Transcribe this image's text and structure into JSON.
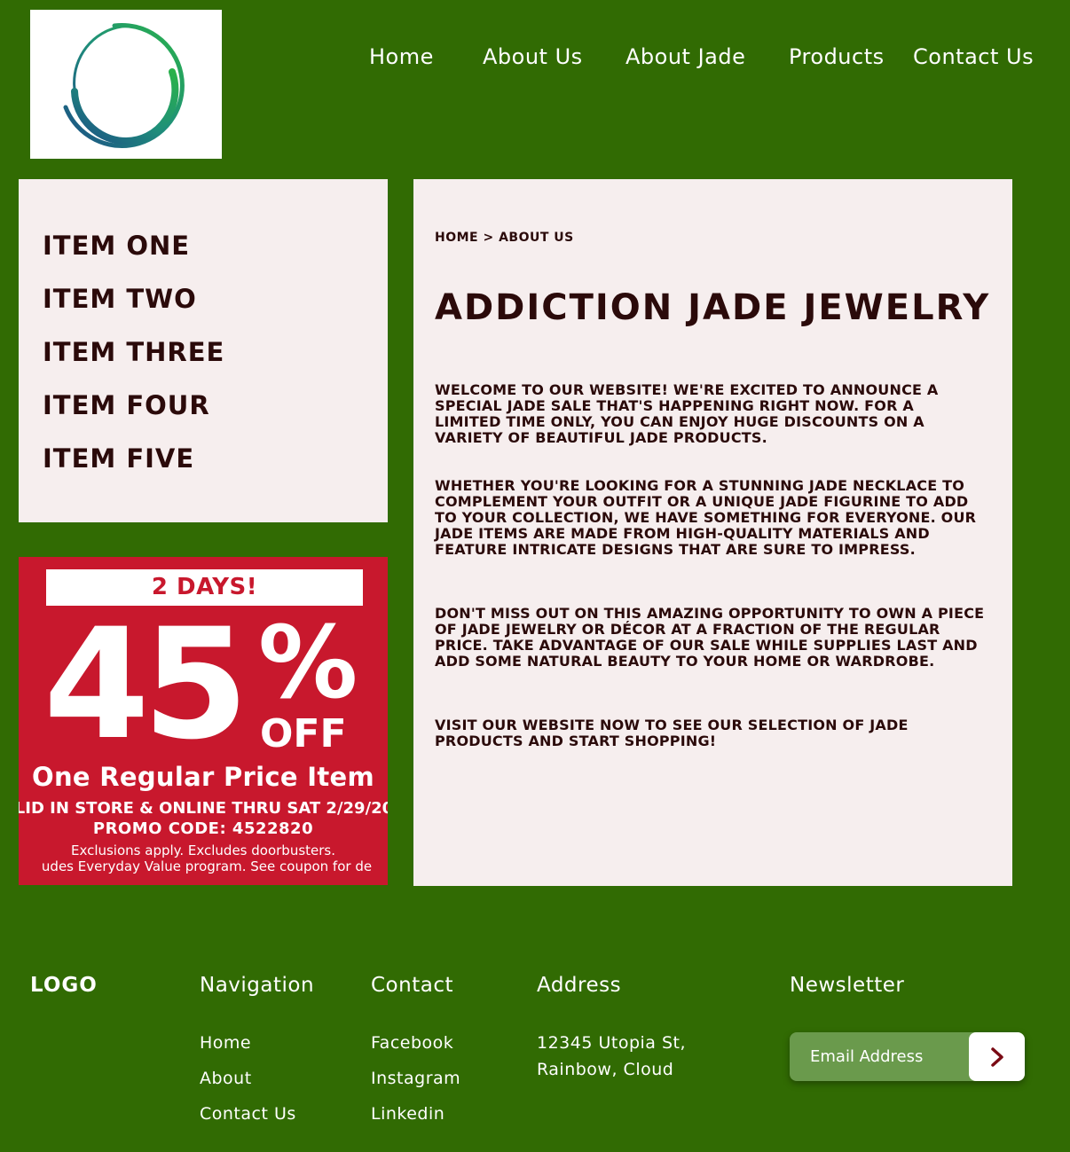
{
  "nav": {
    "items": [
      "Home",
      "About Us",
      "About Jade",
      "Products",
      "Contact Us"
    ]
  },
  "sidebar": {
    "items": [
      "ITEM ONE",
      "ITEM TWO",
      "ITEM THREE",
      "ITEM FOUR",
      "ITEM FIVE"
    ]
  },
  "promo": {
    "days": "2 DAYS!",
    "discount": "45",
    "percent": "%",
    "off": "OFF",
    "line1": "One Regular Price Item",
    "line2": "LID IN STORE & ONLINE THRU SAT 2/29/20",
    "promo_code": "PROMO CODE: 4522820",
    "line4": "Exclusions apply. Excludes doorbusters.",
    "line5": "udes Everyday Value program. See coupon for de"
  },
  "content": {
    "breadcrumb": "HOME > ABOUT US",
    "title": "ADDICTION JADE JEWELRY",
    "paragraphs": [
      "WELCOME TO OUR WEBSITE! WE'RE EXCITED TO ANNOUNCE A SPECIAL JADE SALE THAT'S HAPPENING RIGHT NOW. FOR A LIMITED TIME ONLY, YOU CAN ENJOY HUGE DISCOUNTS ON A VARIETY OF BEAUTIFUL JADE PRODUCTS.",
      "WHETHER YOU'RE LOOKING FOR A STUNNING JADE NECKLACE TO COMPLEMENT YOUR OUTFIT OR A UNIQUE JADE FIGURINE TO ADD TO YOUR COLLECTION, WE HAVE SOMETHING FOR EVERYONE. OUR JADE ITEMS ARE MADE FROM HIGH-QUALITY MATERIALS AND FEATURE INTRICATE DESIGNS THAT ARE SURE TO IMPRESS.",
      "DON'T MISS OUT ON THIS AMAZING OPPORTUNITY TO OWN A PIECE OF JADE JEWELRY OR DÉCOR AT A FRACTION OF THE REGULAR PRICE. TAKE ADVANTAGE OF OUR SALE WHILE SUPPLIES LAST AND ADD SOME NATURAL BEAUTY TO YOUR HOME OR WARDROBE.",
      "VISIT OUR WEBSITE NOW TO SEE OUR SELECTION OF JADE PRODUCTS AND START SHOPPING!"
    ]
  },
  "footer": {
    "logo": "LOGO",
    "navigation": {
      "heading": "Navigation",
      "links": [
        "Home",
        "About",
        "Contact Us"
      ]
    },
    "contact": {
      "heading": "Contact",
      "links": [
        "Facebook",
        "Instagram",
        "Linkedin"
      ]
    },
    "address": {
      "heading": "Address",
      "lines": [
        "12345 Utopia St,",
        "Rainbow, Cloud"
      ]
    },
    "newsletter": {
      "heading": "Newsletter",
      "placeholder": "Email Address"
    }
  },
  "colors": {
    "background": "#316b03",
    "panel": "#f6eeee",
    "text_dark": "#2b0a0a",
    "promo_red": "#c8182d",
    "newsletter_field": "#6a9a4c"
  },
  "icons": {
    "logo": "ring-logo-icon",
    "submit": "chevron-right-icon"
  }
}
